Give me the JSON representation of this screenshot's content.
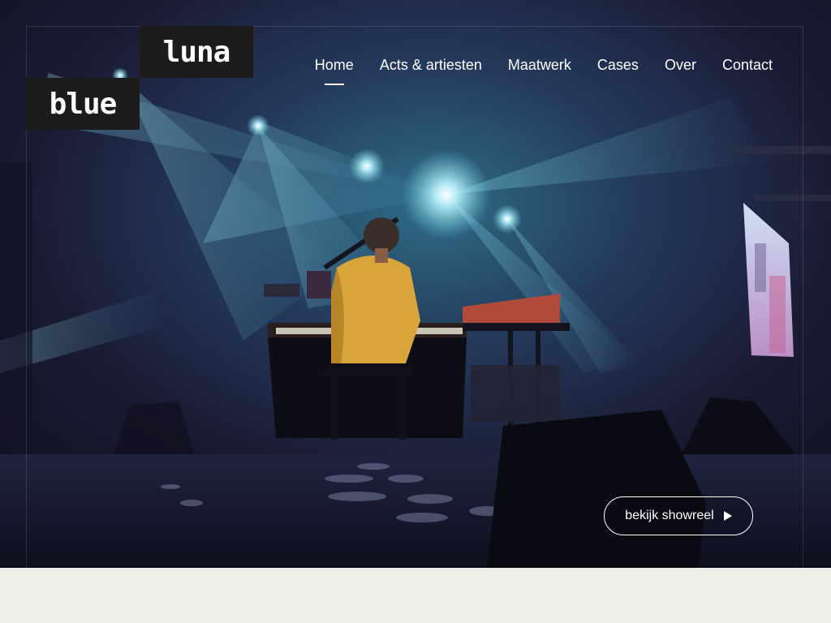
{
  "logo": {
    "line1": "luna",
    "line2": "blue"
  },
  "nav": {
    "items": [
      {
        "label": "Home",
        "active": true
      },
      {
        "label": "Acts & artiesten",
        "active": false
      },
      {
        "label": "Maatwerk",
        "active": false
      },
      {
        "label": "Cases",
        "active": false
      },
      {
        "label": "Over",
        "active": false
      },
      {
        "label": "Contact",
        "active": false
      }
    ]
  },
  "hero": {
    "showreel_label": "bekijk showreel",
    "showreel_icon": "play-icon",
    "image_description_icon": "concert-photo"
  },
  "colors": {
    "logo_bg": "#1d1c1a",
    "page_bg": "#eeede6",
    "text": "#ffffff",
    "stage_light": "#7fe6f0"
  }
}
